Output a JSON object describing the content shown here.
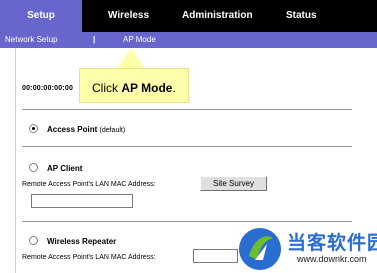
{
  "nav": {
    "tabs": [
      {
        "label": "Setup",
        "active": true
      },
      {
        "label": "Wireless",
        "active": false
      },
      {
        "label": "Administration",
        "active": false
      },
      {
        "label": "Status",
        "active": false
      }
    ],
    "subtabs": [
      {
        "label": "Network Setup"
      },
      {
        "label": "|"
      },
      {
        "label": "AP Mode",
        "active": true
      }
    ]
  },
  "mac_readout": "00:00:00:00:00",
  "callout": {
    "prefix": "Click ",
    "emphasis": "AP Mode",
    "suffix": "."
  },
  "options": {
    "access_point": {
      "label": "Access Point",
      "suffix": "(default)",
      "checked": true
    },
    "ap_client": {
      "label": "AP Client",
      "checked": false,
      "field_label": "Remote Access Point's LAN MAC Address:",
      "button_label": "Site Survey",
      "value": ""
    },
    "wireless_repeater": {
      "label": "Wireless  Repeater",
      "checked": false,
      "field_label": "Remote Access Point's LAN MAC Address:",
      "value": ""
    }
  },
  "watermark": {
    "title": "当客软件园",
    "url": "www.downkr.com"
  },
  "colors": {
    "accent": "#6666cc",
    "nav_bg": "#000000",
    "callout_bg": "#ffffaa",
    "watermark_blue": "#2a6dd1",
    "watermark_green": "#6bbf2a"
  }
}
